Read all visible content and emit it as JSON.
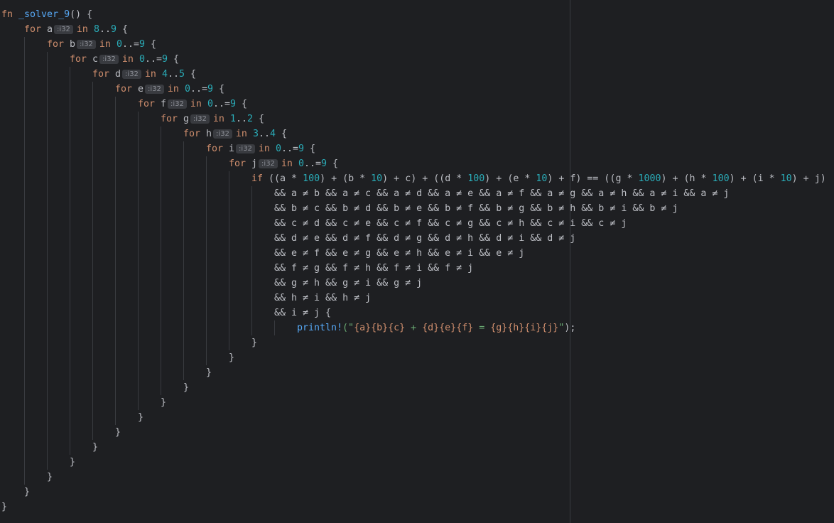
{
  "editor": {
    "lines": [
      {
        "indent": 0,
        "tokens": [
          {
            "t": "fn",
            "c": "kw"
          },
          {
            "t": " "
          },
          {
            "t": "_solver_9",
            "c": "fn"
          },
          {
            "t": "() {"
          }
        ]
      },
      {
        "indent": 1,
        "tokens": [
          {
            "t": "for",
            "c": "kw"
          },
          {
            "t": " a"
          },
          {
            "hint": ":i32"
          },
          {
            "t": "in",
            "c": "kw"
          },
          {
            "t": " "
          },
          {
            "t": "8",
            "c": "num"
          },
          {
            "t": ".."
          },
          {
            "t": "9",
            "c": "num"
          },
          {
            "t": " {"
          }
        ]
      },
      {
        "indent": 2,
        "tokens": [
          {
            "t": "for",
            "c": "kw"
          },
          {
            "t": " b"
          },
          {
            "hint": ":i32"
          },
          {
            "t": "in",
            "c": "kw"
          },
          {
            "t": " "
          },
          {
            "t": "0",
            "c": "num"
          },
          {
            "t": "..="
          },
          {
            "t": "9",
            "c": "num"
          },
          {
            "t": " {"
          }
        ]
      },
      {
        "indent": 3,
        "tokens": [
          {
            "t": "for",
            "c": "kw"
          },
          {
            "t": " c"
          },
          {
            "hint": ":i32"
          },
          {
            "t": "in",
            "c": "kw"
          },
          {
            "t": " "
          },
          {
            "t": "0",
            "c": "num"
          },
          {
            "t": "..="
          },
          {
            "t": "9",
            "c": "num"
          },
          {
            "t": " {"
          }
        ]
      },
      {
        "indent": 4,
        "tokens": [
          {
            "t": "for",
            "c": "kw"
          },
          {
            "t": " d"
          },
          {
            "hint": ":i32"
          },
          {
            "t": "in",
            "c": "kw"
          },
          {
            "t": " "
          },
          {
            "t": "4",
            "c": "num"
          },
          {
            "t": ".."
          },
          {
            "t": "5",
            "c": "num"
          },
          {
            "t": " {"
          }
        ]
      },
      {
        "indent": 5,
        "tokens": [
          {
            "t": "for",
            "c": "kw"
          },
          {
            "t": " e"
          },
          {
            "hint": ":i32"
          },
          {
            "t": "in",
            "c": "kw"
          },
          {
            "t": " "
          },
          {
            "t": "0",
            "c": "num"
          },
          {
            "t": "..="
          },
          {
            "t": "9",
            "c": "num"
          },
          {
            "t": " {"
          }
        ]
      },
      {
        "indent": 6,
        "tokens": [
          {
            "t": "for",
            "c": "kw"
          },
          {
            "t": " f"
          },
          {
            "hint": ":i32"
          },
          {
            "t": "in",
            "c": "kw"
          },
          {
            "t": " "
          },
          {
            "t": "0",
            "c": "num"
          },
          {
            "t": "..="
          },
          {
            "t": "9",
            "c": "num"
          },
          {
            "t": " {"
          }
        ]
      },
      {
        "indent": 7,
        "tokens": [
          {
            "t": "for",
            "c": "kw"
          },
          {
            "t": " g"
          },
          {
            "hint": ":i32"
          },
          {
            "t": "in",
            "c": "kw"
          },
          {
            "t": " "
          },
          {
            "t": "1",
            "c": "num"
          },
          {
            "t": ".."
          },
          {
            "t": "2",
            "c": "num"
          },
          {
            "t": " {"
          }
        ]
      },
      {
        "indent": 8,
        "tokens": [
          {
            "t": "for",
            "c": "kw"
          },
          {
            "t": " h"
          },
          {
            "hint": ":i32"
          },
          {
            "t": "in",
            "c": "kw"
          },
          {
            "t": " "
          },
          {
            "t": "3",
            "c": "num"
          },
          {
            "t": ".."
          },
          {
            "t": "4",
            "c": "num"
          },
          {
            "t": " {"
          }
        ]
      },
      {
        "indent": 9,
        "tokens": [
          {
            "t": "for",
            "c": "kw"
          },
          {
            "t": " i"
          },
          {
            "hint": ":i32"
          },
          {
            "t": "in",
            "c": "kw"
          },
          {
            "t": " "
          },
          {
            "t": "0",
            "c": "num"
          },
          {
            "t": "..="
          },
          {
            "t": "9",
            "c": "num"
          },
          {
            "t": " {"
          }
        ]
      },
      {
        "indent": 10,
        "tokens": [
          {
            "t": "for",
            "c": "kw"
          },
          {
            "t": " j"
          },
          {
            "hint": ":i32"
          },
          {
            "t": "in",
            "c": "kw"
          },
          {
            "t": " "
          },
          {
            "t": "0",
            "c": "num"
          },
          {
            "t": "..="
          },
          {
            "t": "9",
            "c": "num"
          },
          {
            "t": " {"
          }
        ]
      },
      {
        "indent": 11,
        "tokens": [
          {
            "t": "if",
            "c": "kw"
          },
          {
            "t": " ((a * "
          },
          {
            "t": "100",
            "c": "num"
          },
          {
            "t": ") + (b * "
          },
          {
            "t": "10",
            "c": "num"
          },
          {
            "t": ") + c) + ((d * "
          },
          {
            "t": "100",
            "c": "num"
          },
          {
            "t": ") + (e * "
          },
          {
            "t": "10",
            "c": "num"
          },
          {
            "t": ") + f) == ((g * "
          },
          {
            "t": "1000",
            "c": "num"
          },
          {
            "t": ") + (h * "
          },
          {
            "t": "100",
            "c": "num"
          },
          {
            "t": ") + (i * "
          },
          {
            "t": "10",
            "c": "num"
          },
          {
            "t": ") + j)"
          }
        ]
      },
      {
        "indent": 12,
        "tokens": [
          {
            "t": "&& a ≠ b && a ≠ c && a ≠ d && a ≠ e && a ≠ f && a ≠ g && a ≠ h && a ≠ i && a ≠ j"
          }
        ]
      },
      {
        "indent": 12,
        "tokens": [
          {
            "t": "&& b ≠ c && b ≠ d && b ≠ e && b ≠ f && b ≠ g && b ≠ h && b ≠ i && b ≠ j"
          }
        ]
      },
      {
        "indent": 12,
        "tokens": [
          {
            "t": "&& c ≠ d && c ≠ e && c ≠ f && c ≠ g && c ≠ h && c ≠ i && c ≠ j"
          }
        ]
      },
      {
        "indent": 12,
        "tokens": [
          {
            "t": "&& d ≠ e && d ≠ f && d ≠ g && d ≠ h && d ≠ i && d ≠ j"
          }
        ]
      },
      {
        "indent": 12,
        "tokens": [
          {
            "t": "&& e ≠ f && e ≠ g && e ≠ h && e ≠ i && e ≠ j"
          }
        ]
      },
      {
        "indent": 12,
        "tokens": [
          {
            "t": "&& f ≠ g && f ≠ h && f ≠ i && f ≠ j"
          }
        ]
      },
      {
        "indent": 12,
        "tokens": [
          {
            "t": "&& g ≠ h && g ≠ i && g ≠ j"
          }
        ]
      },
      {
        "indent": 12,
        "tokens": [
          {
            "t": "&& h ≠ i && h ≠ j"
          }
        ]
      },
      {
        "indent": 12,
        "tokens": [
          {
            "t": "&& i ≠ j {"
          }
        ]
      },
      {
        "indent": 13,
        "tokens": [
          {
            "t": "println!",
            "c": "macro"
          },
          {
            "t": "(\"",
            "c": "str"
          },
          {
            "t": "{a}{b}{c}",
            "c": "fmt"
          },
          {
            "t": " + ",
            "c": "str"
          },
          {
            "t": "{d}{e}{f}",
            "c": "fmt"
          },
          {
            "t": " = ",
            "c": "str"
          },
          {
            "t": "{g}{h}{i}{j}",
            "c": "fmt"
          },
          {
            "t": "\"",
            "c": "str"
          },
          {
            "t": ");"
          }
        ]
      },
      {
        "indent": 11,
        "tokens": [
          {
            "t": "}"
          }
        ]
      },
      {
        "indent": 10,
        "tokens": [
          {
            "t": "}"
          }
        ]
      },
      {
        "indent": 9,
        "tokens": [
          {
            "t": "}"
          }
        ]
      },
      {
        "indent": 8,
        "tokens": [
          {
            "t": "}"
          }
        ]
      },
      {
        "indent": 7,
        "tokens": [
          {
            "t": "}"
          }
        ]
      },
      {
        "indent": 6,
        "tokens": [
          {
            "t": "}"
          }
        ]
      },
      {
        "indent": 5,
        "tokens": [
          {
            "t": "}"
          }
        ]
      },
      {
        "indent": 4,
        "tokens": [
          {
            "t": "}"
          }
        ]
      },
      {
        "indent": 3,
        "tokens": [
          {
            "t": "}"
          }
        ]
      },
      {
        "indent": 2,
        "tokens": [
          {
            "t": "}"
          }
        ]
      },
      {
        "indent": 1,
        "tokens": [
          {
            "t": "}"
          }
        ]
      },
      {
        "indent": 0,
        "tokens": [
          {
            "t": "}"
          }
        ]
      }
    ]
  }
}
